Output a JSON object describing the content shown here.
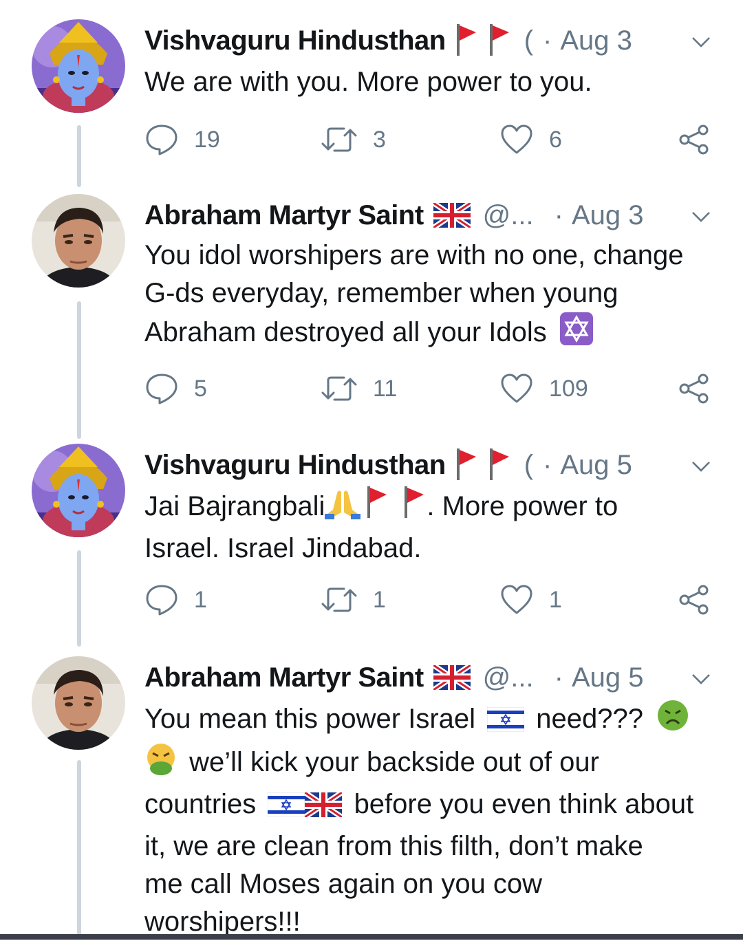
{
  "tweets": [
    {
      "author": "Vishvaguru Hindusthan",
      "handle": "(",
      "dot": "·",
      "date": "Aug 3",
      "lines": [
        "We are with you. More power to you."
      ],
      "replies": "19",
      "retweets": "3",
      "likes": "6"
    },
    {
      "author": "Abraham Martyr Saint",
      "handle": "@...",
      "dot": "·",
      "date": "Aug 3",
      "lines": [
        "You idol worshipers are with no one, change",
        "G-ds everyday, remember when young",
        "Abraham destroyed all your Idols"
      ],
      "replies": "5",
      "retweets": "11",
      "likes": "109"
    },
    {
      "author": "Vishvaguru Hindusthan",
      "handle": "(",
      "dot": "·",
      "date": "Aug 5",
      "lines": [
        "Jai Bajrangbali",
        ". More power to",
        "Israel.  Israel Jindabad."
      ],
      "replies": "1",
      "retweets": "1",
      "likes": "1"
    },
    {
      "author": "Abraham Martyr Saint",
      "handle": "@...",
      "dot": "·",
      "date": "Aug 5",
      "lines": [
        "You mean this power Israel",
        "need???",
        "we’ll kick your backside out of our",
        "countries",
        "before you even think about",
        "it, we are clean from this filth, don’t make",
        "me call Moses again on you cow",
        "worshipers!!!"
      ]
    }
  ],
  "icons": {
    "reply": "reply-icon",
    "retweet": "retweet-icon",
    "like": "heart-icon",
    "share": "share-icon",
    "more": "chevron-down-icon",
    "flag_red": "red-flag-emoji",
    "flag_uk": "uk-flag-emoji",
    "flag_israel": "israel-flag-emoji",
    "star_of_david": "star-of-david-emoji",
    "pray": "folded-hands-emoji",
    "nauseated": "nauseated-face-emoji",
    "vomit": "vomiting-face-emoji"
  },
  "colors": {
    "text": "#14171a",
    "muted": "#657786",
    "thread_line": "#cdd6dd",
    "flag_red": "#e0202e",
    "israel_blue": "#1a3fbd",
    "star_purple": "#8a5cc7"
  }
}
